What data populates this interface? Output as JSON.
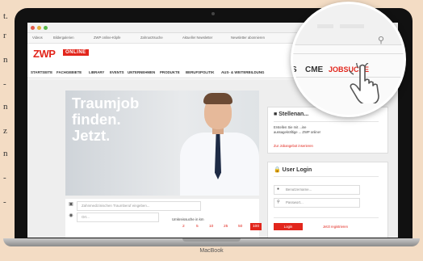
{
  "side_text": [
    "t.",
    "r",
    "n",
    "-",
    "n",
    "z",
    "n",
    "-",
    "-"
  ],
  "browser": {
    "bookmarks": [
      "Videos",
      "Bildergalerien",
      "ZWP online-Klipfe",
      "Zahnarztsuche",
      "Aktueller Newsletter",
      "Newsletter abonnieren"
    ]
  },
  "logo": {
    "name": "ZWP",
    "badge": "ONLINE"
  },
  "nav": [
    "STARTSEITE",
    "FACHGEBIETE",
    "LIBRARY",
    "EVENTS",
    "UNTERNEHMEN",
    "PRODUKTE",
    "BERUFSPOLITIK",
    "AUS- & WEITERBILDUNG"
  ],
  "hero": {
    "line1": "Traumjob",
    "line2": "finden.",
    "line3": "Jetzt."
  },
  "search": {
    "field1_placeholder": "Zahnmedizinischen Traumberuf eingeben...",
    "field2_placeholder": "Ort...",
    "radius_label": "Umkreissuche in km",
    "radius_options": [
      "2",
      "5",
      "10",
      "25",
      "50",
      "100"
    ],
    "radius_selected": "100"
  },
  "stellenanzeige": {
    "title": "Stellenan...",
    "text": "Erstellen Sie mit ...ine aussagekräftige ... ZWP online!",
    "link": "Zur Jobangebot inserieren"
  },
  "login": {
    "title": "User Login",
    "username_placeholder": "Benutzername...",
    "password_placeholder": "Passwort...",
    "login_label": "Login",
    "register_label": "Jetzt registrieren"
  },
  "magnifier": {
    "s": "S",
    "cme": "CME",
    "jobsuche": "JOBSUCHE"
  },
  "laptop_brand": "MacBook",
  "colors": {
    "accent": "#e2261c"
  }
}
